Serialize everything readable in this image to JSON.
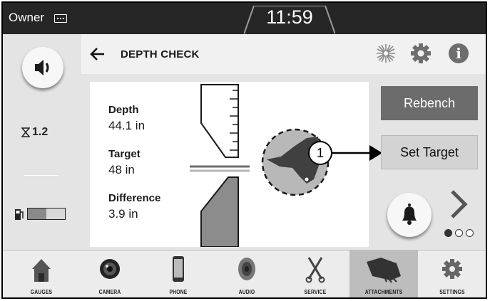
{
  "status_bar": {
    "user": "Owner",
    "time": "11:59"
  },
  "left_rail": {
    "hours_value": "1.2",
    "fuel_level_percent": 50
  },
  "header": {
    "title": "DEPTH CHECK"
  },
  "readouts": {
    "depth_label": "Depth",
    "depth_value": "44.1 in",
    "target_label": "Target",
    "target_value": "48 in",
    "difference_label": "Difference",
    "difference_value": "3.9 in"
  },
  "right_rail": {
    "rebench_label": "Rebench",
    "set_target_label": "Set Target",
    "page_dots": [
      true,
      false,
      false
    ]
  },
  "callout": {
    "number": "1"
  },
  "bottom_nav": [
    {
      "label": "GAUGES",
      "icon": "house-icon"
    },
    {
      "label": "CAMERA",
      "icon": "camera-icon"
    },
    {
      "label": "PHONE",
      "icon": "phone-icon"
    },
    {
      "label": "AUDIO",
      "icon": "speaker-icon"
    },
    {
      "label": "SERVICE",
      "icon": "wrench-icon"
    },
    {
      "label": "ATTACHMENTS",
      "icon": "bucket-icon",
      "active": true
    },
    {
      "label": "SETTINGS",
      "icon": "settings-gear-icon"
    }
  ],
  "colors": {
    "active_tab": "#bdbdbd",
    "rebench_button": "#6c6c6c",
    "top_bar": "#262626"
  }
}
